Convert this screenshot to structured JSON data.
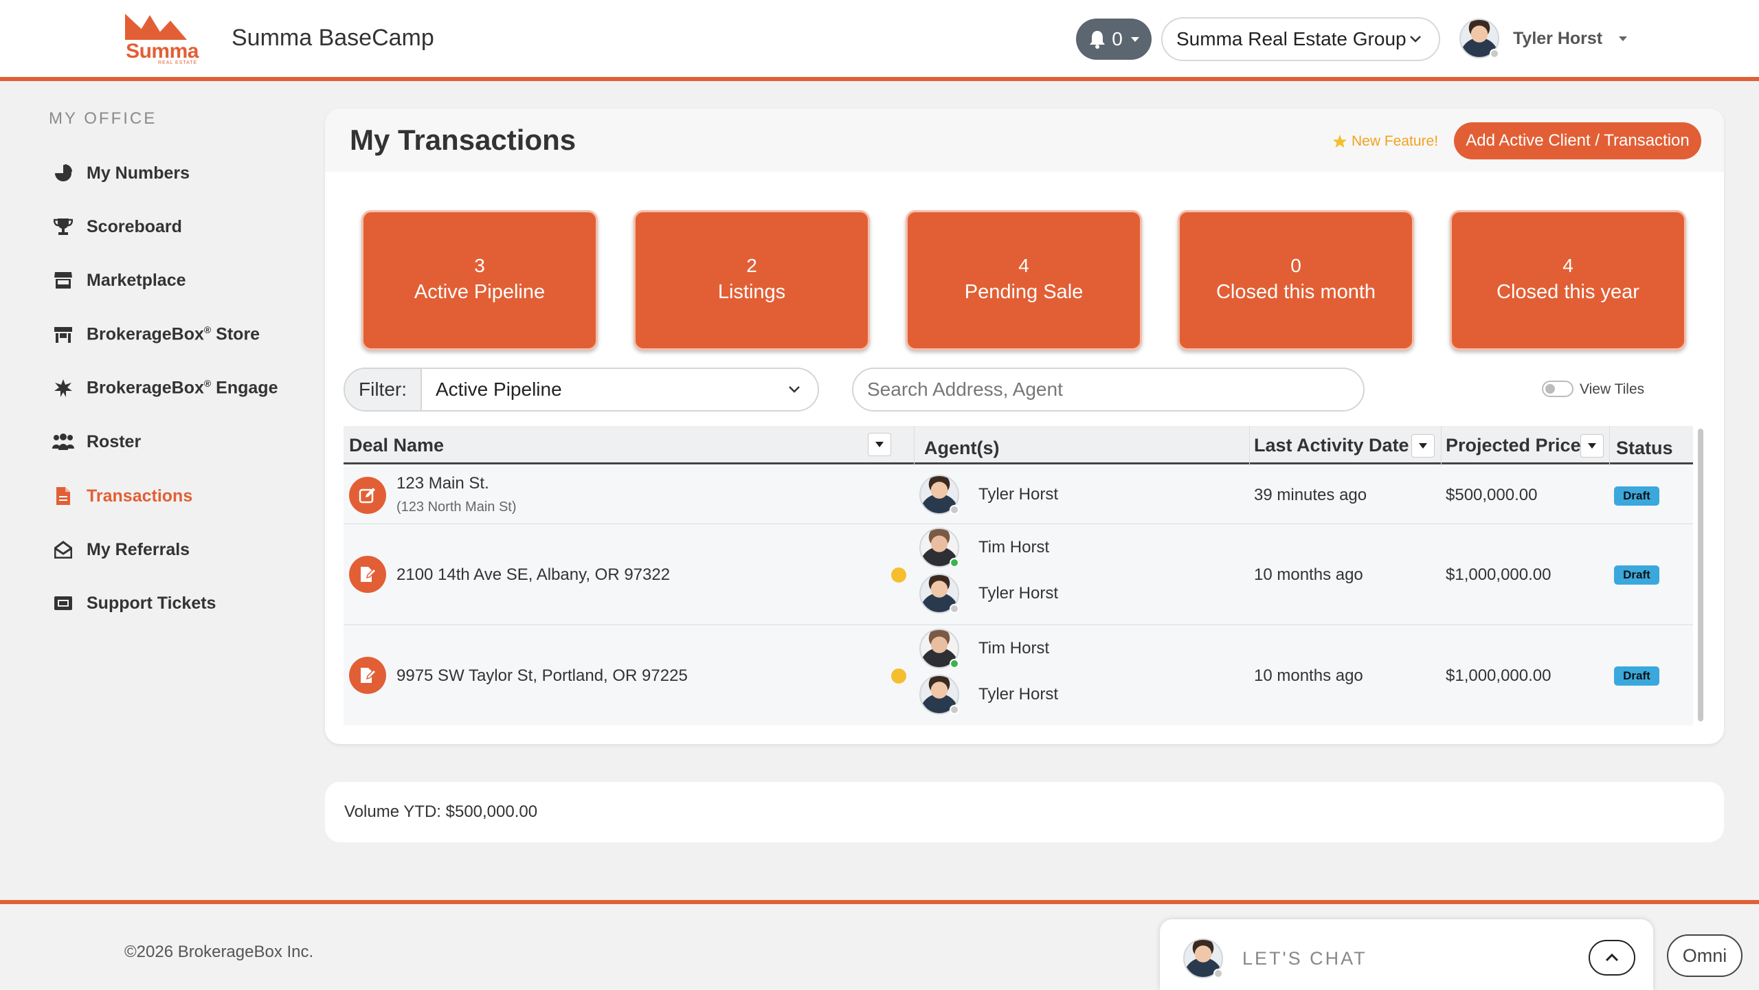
{
  "header": {
    "logo_text": "Summa",
    "logo_subtext": "REAL ESTATE",
    "app_title": "Summa BaseCamp",
    "notifications_count": "0",
    "organization": "Summa Real Estate Group",
    "user_name": "Tyler Horst"
  },
  "sidebar": {
    "heading": "MY OFFICE",
    "items": [
      {
        "label": "My Numbers",
        "icon": "chart-pie-icon"
      },
      {
        "label": "Scoreboard",
        "icon": "trophy-icon"
      },
      {
        "label": "Marketplace",
        "icon": "store-icon"
      },
      {
        "label": "BrokerageBox",
        "reg": "®",
        "suffix": " Store",
        "icon": "shop-icon"
      },
      {
        "label": "BrokerageBox",
        "reg": "®",
        "suffix": " Engage",
        "icon": "burst-icon"
      },
      {
        "label": "Roster",
        "icon": "people-icon"
      },
      {
        "label": "Transactions",
        "icon": "document-icon",
        "active": true
      },
      {
        "label": "My Referrals",
        "icon": "envelope-open-icon"
      },
      {
        "label": "Support Tickets",
        "icon": "ticket-icon"
      }
    ]
  },
  "main": {
    "title": "My Transactions",
    "new_feature": "New Feature!",
    "add_button": "Add Active Client / Transaction",
    "tiles": [
      {
        "count": "3",
        "label": "Active Pipeline"
      },
      {
        "count": "2",
        "label": "Listings"
      },
      {
        "count": "4",
        "label": "Pending Sale"
      },
      {
        "count": "0",
        "label": "Closed this month"
      },
      {
        "count": "4",
        "label": "Closed this year"
      }
    ],
    "filter_label": "Filter:",
    "filter_value": "Active Pipeline",
    "search_placeholder": "Search Address, Agent",
    "view_tiles_label": "View Tiles",
    "table": {
      "columns": [
        "Deal Name",
        "Agent(s)",
        "Last Activity Date",
        "Projected Price",
        "Status"
      ],
      "rows": [
        {
          "deal": "123 Main St.",
          "sub": "(123 North Main St)",
          "agents": [
            "Tyler Horst"
          ],
          "last_activity": "39 minutes ago",
          "price": "$500,000.00",
          "status": "Draft"
        },
        {
          "deal": "2100 14th Ave SE, Albany, OR 97322",
          "sub": "",
          "agents": [
            "Tim Horst",
            "Tyler Horst"
          ],
          "last_activity": "10 months ago",
          "price": "$1,000,000.00",
          "status": "Draft"
        },
        {
          "deal": "9975 SW Taylor St, Portland, OR 97225",
          "sub": "",
          "agents": [
            "Tim Horst",
            "Tyler Horst"
          ],
          "last_activity": "10 months ago",
          "price": "$1,000,000.00",
          "status": "Draft"
        }
      ]
    },
    "volume": "Volume YTD: $500,000.00"
  },
  "footer": {
    "copyright": "©2026 BrokerageBox Inc.",
    "chat_label": "LET'S CHAT",
    "omni_label": "Omni"
  },
  "colors": {
    "brand": "#e25f35",
    "badge": "#3aa8dd",
    "pending_dot": "#f4be2e"
  }
}
